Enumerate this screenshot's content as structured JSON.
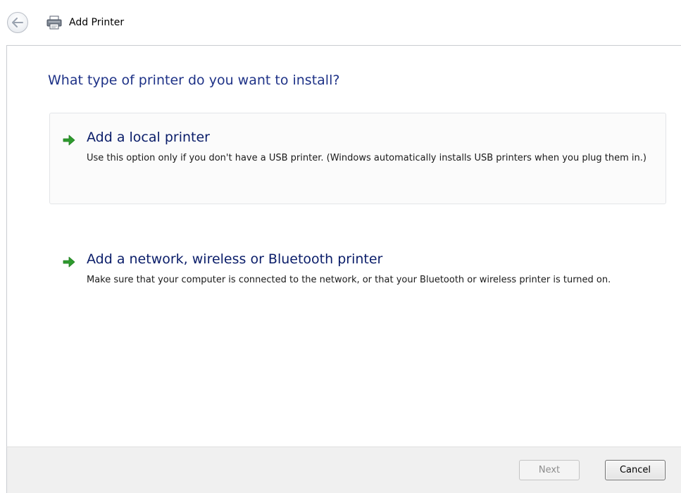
{
  "header": {
    "title": "Add Printer",
    "back_icon": "back-arrow-icon",
    "app_icon": "printer-icon"
  },
  "main": {
    "question": "What type of printer do you want to install?",
    "options": [
      {
        "title": "Add a local printer",
        "description": "Use this option only if you don't have a USB printer. (Windows automatically installs USB printers when you plug them in.)",
        "icon": "green-arrow-icon"
      },
      {
        "title": "Add a network, wireless or Bluetooth printer",
        "description": "Make sure that your computer is connected to the network, or that your Bluetooth or wireless printer is turned on.",
        "icon": "green-arrow-icon"
      }
    ]
  },
  "footer": {
    "next_label": "Next",
    "cancel_label": "Cancel",
    "next_enabled": false
  },
  "colors": {
    "heading": "#1e3287",
    "option_title": "#0a1d69",
    "arrow": "#2e9b2e",
    "footer_bg": "#f0f0f0"
  }
}
